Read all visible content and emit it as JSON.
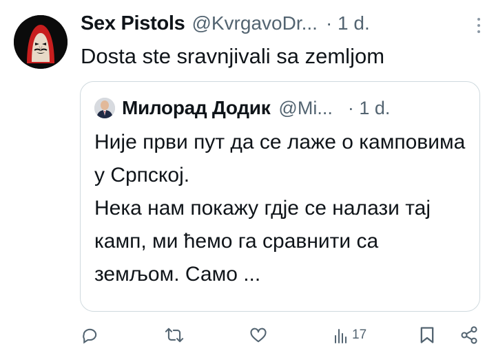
{
  "tweet": {
    "author_name": "Sex Pistols",
    "author_handle": "@KvrgavoDr...",
    "time": "· 1 d.",
    "text": "Dosta ste sravnjivali sa zemljom"
  },
  "quoted_tweet": {
    "author_name": "Милорад Додик",
    "author_handle": "@Mi...",
    "time": "· 1 d.",
    "lines": [
      "Није први пут да се лаже о камповима у Српској.",
      "Нека нам покажу гдје се налази тај камп, ми ћемо га сравнити са земљом. Само ..."
    ]
  },
  "actions": {
    "reply_icon": "reply-icon",
    "retweet_icon": "retweet-icon",
    "like_icon": "like-icon",
    "views_icon": "views-icon",
    "views_count": "17",
    "bookmark_icon": "bookmark-icon",
    "share_icon": "share-icon"
  },
  "colors": {
    "text_primary": "#0f1419",
    "text_secondary": "#536471",
    "border": "#cfd9de"
  }
}
